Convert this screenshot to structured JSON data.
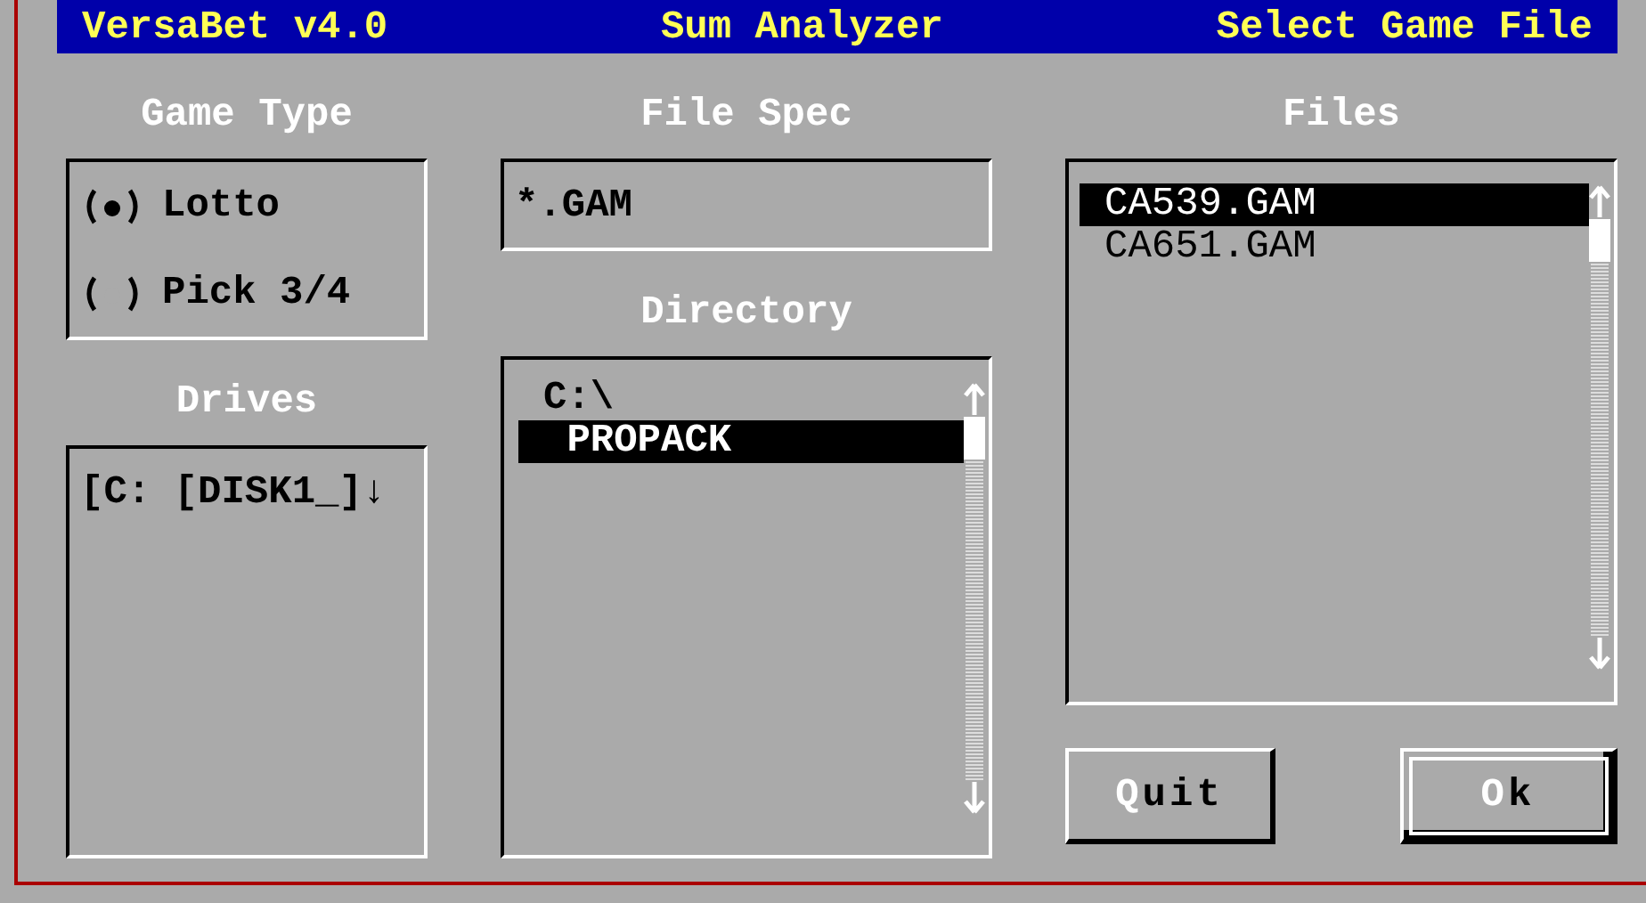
{
  "title_bar": {
    "app": "VersaBet v4.0",
    "module": "Sum Analyzer",
    "screen": "Select Game File"
  },
  "game_type": {
    "label": "Game Type",
    "options": [
      {
        "label": "Lotto",
        "selected": true
      },
      {
        "label": "Pick 3/4",
        "selected": false
      }
    ]
  },
  "drives": {
    "label": "Drives",
    "value": "[C: [DISK1_]↓"
  },
  "file_spec": {
    "label": "File Spec",
    "value": "*.GAM"
  },
  "directory": {
    "label": "Directory",
    "items": [
      {
        "name": "C:\\",
        "selected": false
      },
      {
        "name": " PROPACK",
        "selected": true
      }
    ]
  },
  "files": {
    "label": "Files",
    "items": [
      {
        "name": "CA539.GAM",
        "selected": true
      },
      {
        "name": "CA651.GAM",
        "selected": false
      }
    ]
  },
  "buttons": [
    {
      "hotkey": "Q",
      "rest": "uit",
      "default": false
    },
    {
      "hotkey": "O",
      "rest": "k",
      "default": true
    }
  ]
}
